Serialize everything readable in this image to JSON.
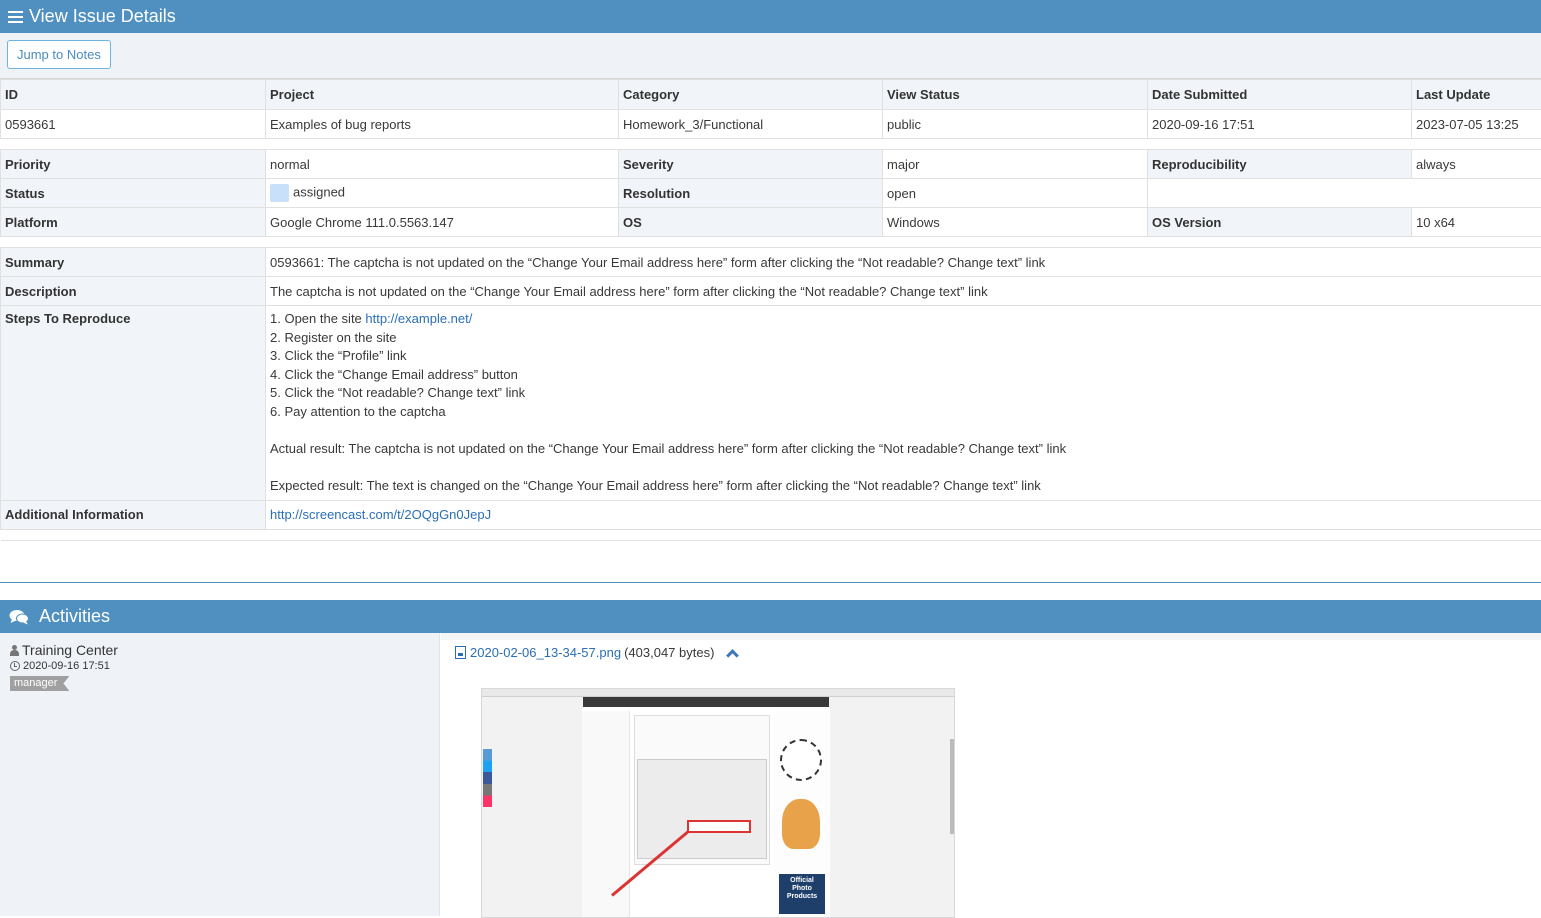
{
  "header": {
    "title": "View Issue Details"
  },
  "toolbar": {
    "jump_label": "Jump to Notes"
  },
  "summary_headers": [
    "ID",
    "Project",
    "Category",
    "View Status",
    "Date Submitted",
    "Last Update"
  ],
  "summary_values": [
    "0593661",
    "Examples of bug reports",
    "Homework_3/Functional",
    "public",
    "2020-09-16 17:51",
    "2023-07-05 13:25"
  ],
  "fields": {
    "priority_label": "Priority",
    "priority": "normal",
    "severity_label": "Severity",
    "severity": "major",
    "reproducibility_label": "Reproducibility",
    "reproducibility": "always",
    "status_label": "Status",
    "status": "assigned",
    "status_color": "#c8e0fa",
    "resolution_label": "Resolution",
    "resolution": "open",
    "platform_label": "Platform",
    "platform": "Google Chrome 111.0.5563.147",
    "os_label": "OS",
    "os": "Windows",
    "os_version_label": "OS Version",
    "os_version": "10 x64"
  },
  "details": {
    "summary_label": "Summary",
    "summary": "0593661: The captcha is not updated on the “Change Your Email address here” form after clicking the “Not readable? Change text” link",
    "description_label": "Description",
    "description": "The captcha is not updated on the “Change Your Email address here” form after clicking the “Not readable? Change text” link",
    "steps_label": "Steps To Reproduce",
    "steps": {
      "step1_prefix": "1. Open the site ",
      "step1_link": "http://example.net/",
      "step2": "2. Register on the site",
      "step3": "3. Click the “Profile” link",
      "step4": "4. Click the “Change Email address” button",
      "step5": "5. Click the “Not readable? Change text” link",
      "step6": "6. Pay attention to the captcha",
      "actual": "Actual result: The captcha is not updated on the “Change Your Email address here” form after clicking the “Not readable? Change text” link",
      "expected": "Expected result: The text is changed on the “Change Your Email address here” form after clicking the “Not readable? Change text” link"
    },
    "additional_label": "Additional Information",
    "additional_link": "http://screencast.com/t/2OQgGn0JepJ"
  },
  "activities": {
    "title": "Activities",
    "user": "Training Center",
    "date": "2020-09-16 17:51",
    "role": "manager",
    "attachment_name": "2020-02-06_13-34-57.png",
    "attachment_size": "(403,047 bytes)",
    "thumb_text": {
      "photo_line1": "Official",
      "photo_line2": "Photo",
      "photo_line3": "Products"
    }
  },
  "colors": {
    "header_bg": "#5090c1",
    "label_bg": "#f1f5f9",
    "link": "#2a6fb5"
  }
}
